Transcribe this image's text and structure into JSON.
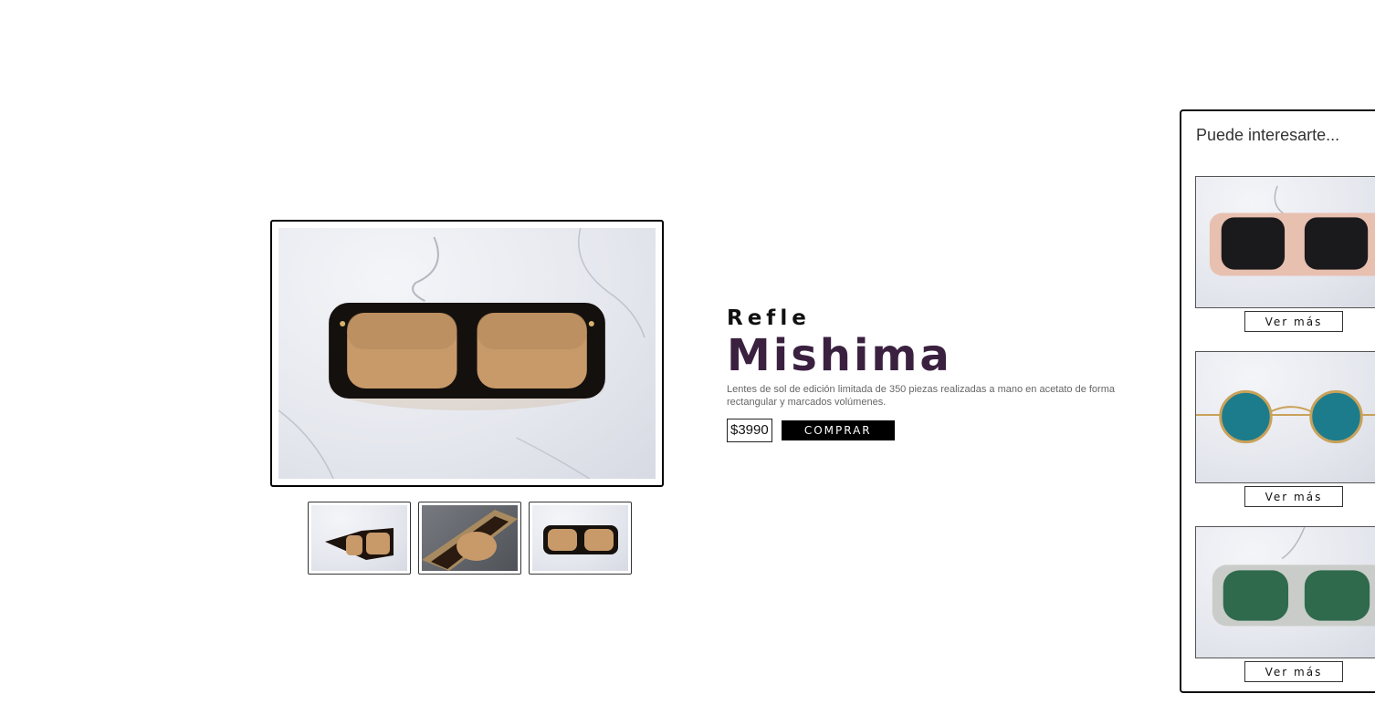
{
  "product": {
    "brand": "Refle",
    "model": "Mishima",
    "description": "Lentes de sol de edición limitada de 350 piezas realizadas a mano en acetato de forma rectangular y marcados volúmenes.",
    "price": "$3990",
    "buy_label": "COMPRAR",
    "main_image_icon": "sunglasses-photo",
    "thumbnails": [
      {
        "icon": "sunglasses-side-photo"
      },
      {
        "icon": "sunglasses-detail-photo"
      },
      {
        "icon": "sunglasses-front-photo"
      }
    ]
  },
  "sidebar": {
    "title": "Puede interesarte...",
    "items": [
      {
        "icon": "pink-sunglasses-photo",
        "button_label": "Ver más"
      },
      {
        "icon": "round-blue-sunglasses-photo",
        "button_label": "Ver más"
      },
      {
        "icon": "clear-green-sunglasses-photo",
        "button_label": "Ver más"
      }
    ]
  },
  "colors": {
    "accent": "#3b2140",
    "button_bg": "#000000"
  }
}
